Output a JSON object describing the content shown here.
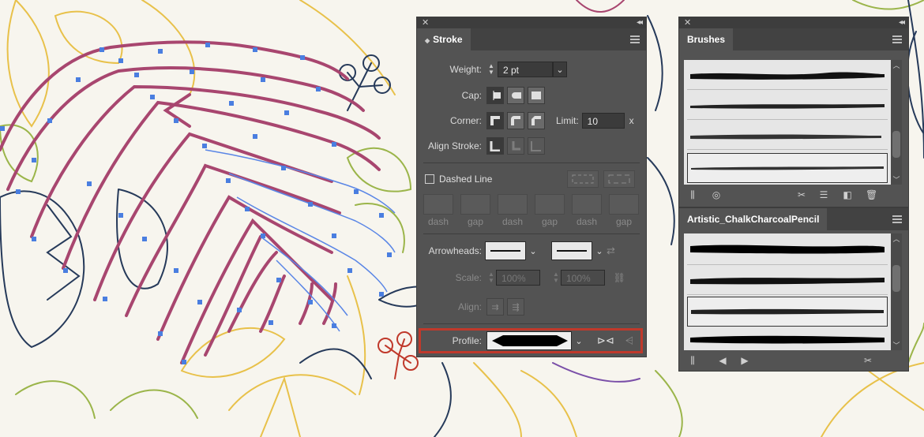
{
  "stroke_panel": {
    "tab": "Stroke",
    "weight_label": "Weight:",
    "weight_value": "2 pt",
    "cap_label": "Cap:",
    "corner_label": "Corner:",
    "limit_label": "Limit:",
    "limit_value": "10",
    "limit_unit": "x",
    "align_label": "Align Stroke:",
    "dashed_label": "Dashed Line",
    "dash_labels": [
      "dash",
      "gap",
      "dash",
      "gap",
      "dash",
      "gap"
    ],
    "arrowheads_label": "Arrowheads:",
    "scale_label": "Scale:",
    "scale_value_1": "100%",
    "scale_value_2": "100%",
    "align_arrow_label": "Align:",
    "profile_label": "Profile:",
    "highlight_color": "#c0392b"
  },
  "brushes_panel": {
    "tab": "Brushes"
  },
  "library_panel": {
    "tab": "Artistic_ChalkCharcoalPencil"
  },
  "colors": {
    "panel_bg": "#535353",
    "path_magenta": "#a8466f",
    "anchor_blue": "#4a7ee0"
  }
}
